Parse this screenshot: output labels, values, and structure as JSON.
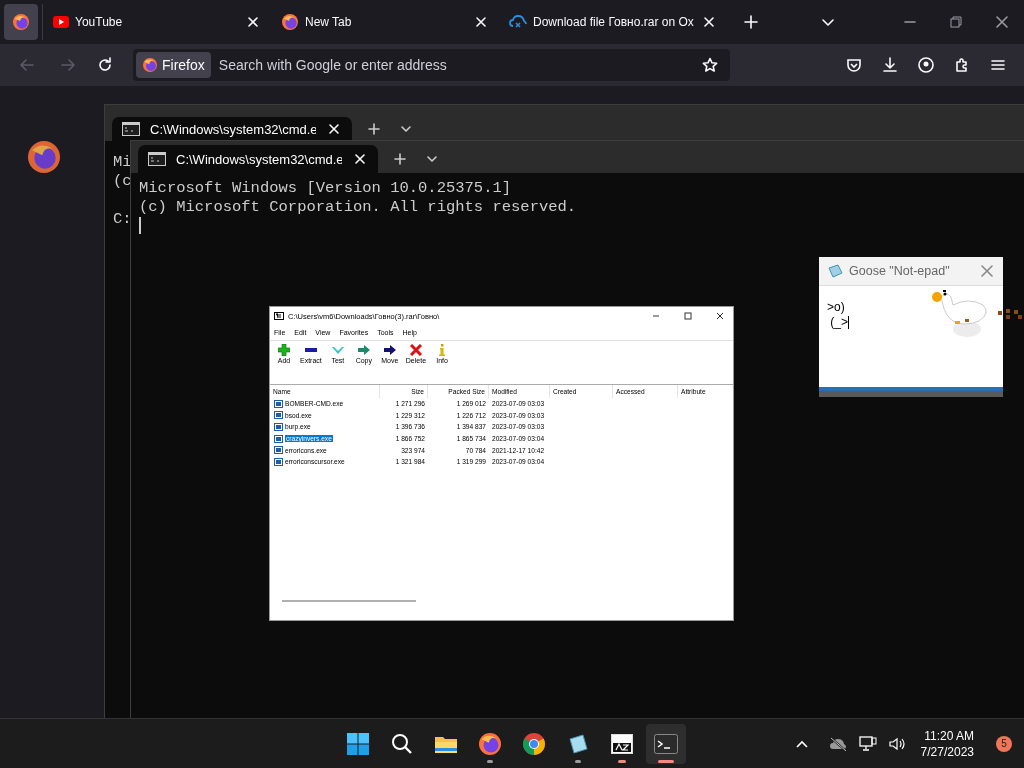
{
  "browser": {
    "tabs": [
      {
        "kind": "pinned",
        "selected": true
      },
      {
        "kind": "youtube",
        "title": "YouTube",
        "selected": false
      },
      {
        "kind": "firefox",
        "title": "New Tab",
        "selected": false
      },
      {
        "kind": "site",
        "title": "Download file Говно.rar on Ox",
        "selected": false
      }
    ],
    "back_disabled": true,
    "forward_disabled": true,
    "identity": "Firefox",
    "address_placeholder": "Search with Google or enter address"
  },
  "terminal_back": {
    "tab_title": "C:\\Windows\\system32\\cmd.e",
    "lines": [
      "Mi",
      "(c"
    ],
    "prompt": "C:"
  },
  "terminal_front": {
    "tab_title": "C:\\Windows\\system32\\cmd.e",
    "lines": [
      "Microsoft Windows [Version 10.0.25375.1]",
      "(c) Microsoft Corporation. All rights reserved."
    ]
  },
  "archive_window": {
    "title": "C:\\Users\\vm6\\Downloads\\Говно(3).rar\\Говно\\",
    "menu": [
      "File",
      "Edit",
      "View",
      "Favorites",
      "Tools",
      "Help"
    ],
    "toolbar": [
      {
        "kind": "add",
        "label": "Add"
      },
      {
        "kind": "extract",
        "label": "Extract"
      },
      {
        "kind": "test",
        "label": "Test"
      },
      {
        "kind": "copy",
        "label": "Copy"
      },
      {
        "kind": "move",
        "label": "Move"
      },
      {
        "kind": "delete",
        "label": "Delete"
      },
      {
        "kind": "info",
        "label": "Info"
      }
    ],
    "columns": [
      "Name",
      "Size",
      "Packed Size",
      "Modified",
      "Created",
      "Accessed",
      "Attribute"
    ],
    "rows": [
      {
        "name": "BOMBER-CMD.exe",
        "size": "1 271 296",
        "packed": "1 269 012",
        "modified": "2023-07-09 03:03",
        "selected": false
      },
      {
        "name": "bsod.exe",
        "size": "1 229 312",
        "packed": "1 226 712",
        "modified": "2023-07-09 03:03",
        "selected": false
      },
      {
        "name": "burp.exe",
        "size": "1 396 736",
        "packed": "1 394 837",
        "modified": "2023-07-09 03:03",
        "selected": false
      },
      {
        "name": "crazyinvers.exe",
        "size": "1 866 752",
        "packed": "1 865 734",
        "modified": "2023-07-09 03:04",
        "selected": true
      },
      {
        "name": "erroricons.exe",
        "size": "323 974",
        "packed": "70 784",
        "modified": "2021-12-17 10:42",
        "selected": false
      },
      {
        "name": "erroriconscursor.exe",
        "size": "1 321 984",
        "packed": "1 319 299",
        "modified": "2023-07-09 03:04",
        "selected": false
      }
    ]
  },
  "notepad": {
    "title": "Goose \"Not-epad\"",
    "lines": [
      ">o)",
      " (_>"
    ]
  },
  "taskbar": {
    "apps": [
      {
        "kind": "start",
        "running": false,
        "focused": false,
        "selected": false
      },
      {
        "kind": "search",
        "running": false,
        "focused": false,
        "selected": false
      },
      {
        "kind": "files",
        "running": false,
        "focused": false,
        "selected": false
      },
      {
        "kind": "firefox",
        "running": true,
        "focused": false,
        "selected": false
      },
      {
        "kind": "chrome",
        "running": false,
        "focused": false,
        "selected": false
      },
      {
        "kind": "notepad",
        "running": true,
        "focused": false,
        "selected": false
      },
      {
        "kind": "archiver",
        "running": true,
        "focused": true,
        "selected": false
      },
      {
        "kind": "terminal",
        "running": true,
        "focused": true,
        "selected": true
      }
    ],
    "time": "11:20 AM",
    "date": "7/27/2023",
    "notifications": "5"
  }
}
